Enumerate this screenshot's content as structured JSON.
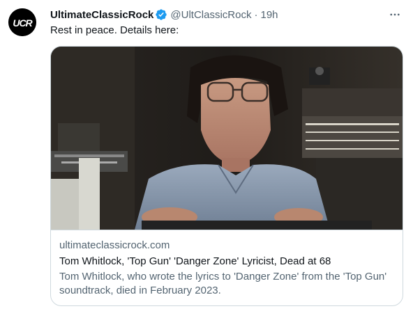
{
  "author": {
    "display_name": "UltimateClassicRock",
    "handle": "@UltClassicRock",
    "separator": "·",
    "time": "19h",
    "avatar_letters": "UCR"
  },
  "tweet": {
    "text": "Rest in peace. Details here:"
  },
  "card": {
    "domain": "ultimateclassicrock.com",
    "title": "Tom Whitlock, 'Top Gun' 'Danger Zone' Lyricist, Dead at 68",
    "description": "Tom Whitlock, who wrote the lyrics to 'Danger Zone' from the 'Top Gun' soundtrack, died in February 2023."
  },
  "icons": {
    "verified": "verified-badge-icon",
    "more": "more-horizontal-icon"
  },
  "colors": {
    "verified": "#1d9bf0",
    "secondary_text": "#536471",
    "primary_text": "#0f1419",
    "border": "#cfd9de"
  }
}
